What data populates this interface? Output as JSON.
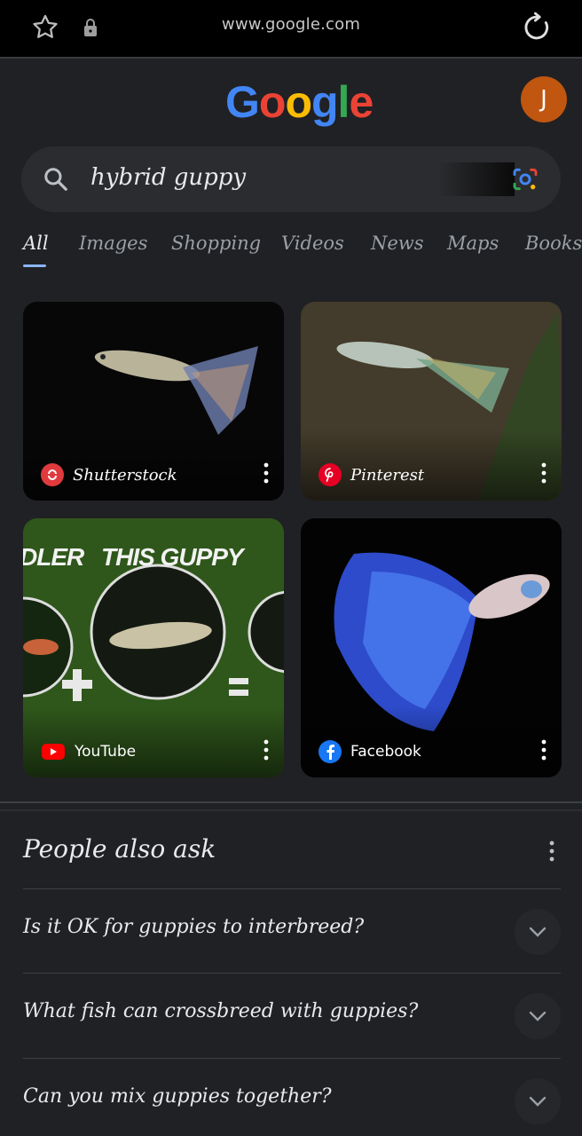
{
  "browser": {
    "url": "www.google.com"
  },
  "header": {
    "logo_letters": [
      "G",
      "o",
      "o",
      "g",
      "l",
      "e"
    ],
    "logo_colors": [
      "#4285f4",
      "#ea4335",
      "#fbbc05",
      "#4285f4",
      "#34a853",
      "#ea4335"
    ],
    "avatar_letter": "J",
    "avatar_color": "#c0560f"
  },
  "search": {
    "query": "hybrid guppy"
  },
  "tabs": [
    {
      "label": "All",
      "active": true
    },
    {
      "label": "Images"
    },
    {
      "label": "Shopping"
    },
    {
      "label": "Videos"
    },
    {
      "label": "News"
    },
    {
      "label": "Maps"
    },
    {
      "label": "Books"
    }
  ],
  "images": [
    {
      "source": "Shutterstock",
      "icon": "shutterstock-icon",
      "icon_color": "#e03a3e"
    },
    {
      "source": "Pinterest",
      "icon": "pinterest-icon",
      "icon_color": "#e60023"
    },
    {
      "source": "YouTube",
      "icon": "youtube-icon",
      "icon_color": "#ff0000",
      "overlay_left": "DLER",
      "overlay_right": "THIS GUPPY"
    },
    {
      "source": "Facebook",
      "icon": "facebook-icon",
      "icon_color": "#1877f2"
    }
  ],
  "people_also_ask": {
    "title": "People also ask",
    "questions": [
      "Is it OK for guppies to interbreed?",
      "What fish can crossbreed with guppies?",
      "Can you mix guppies together?"
    ]
  }
}
